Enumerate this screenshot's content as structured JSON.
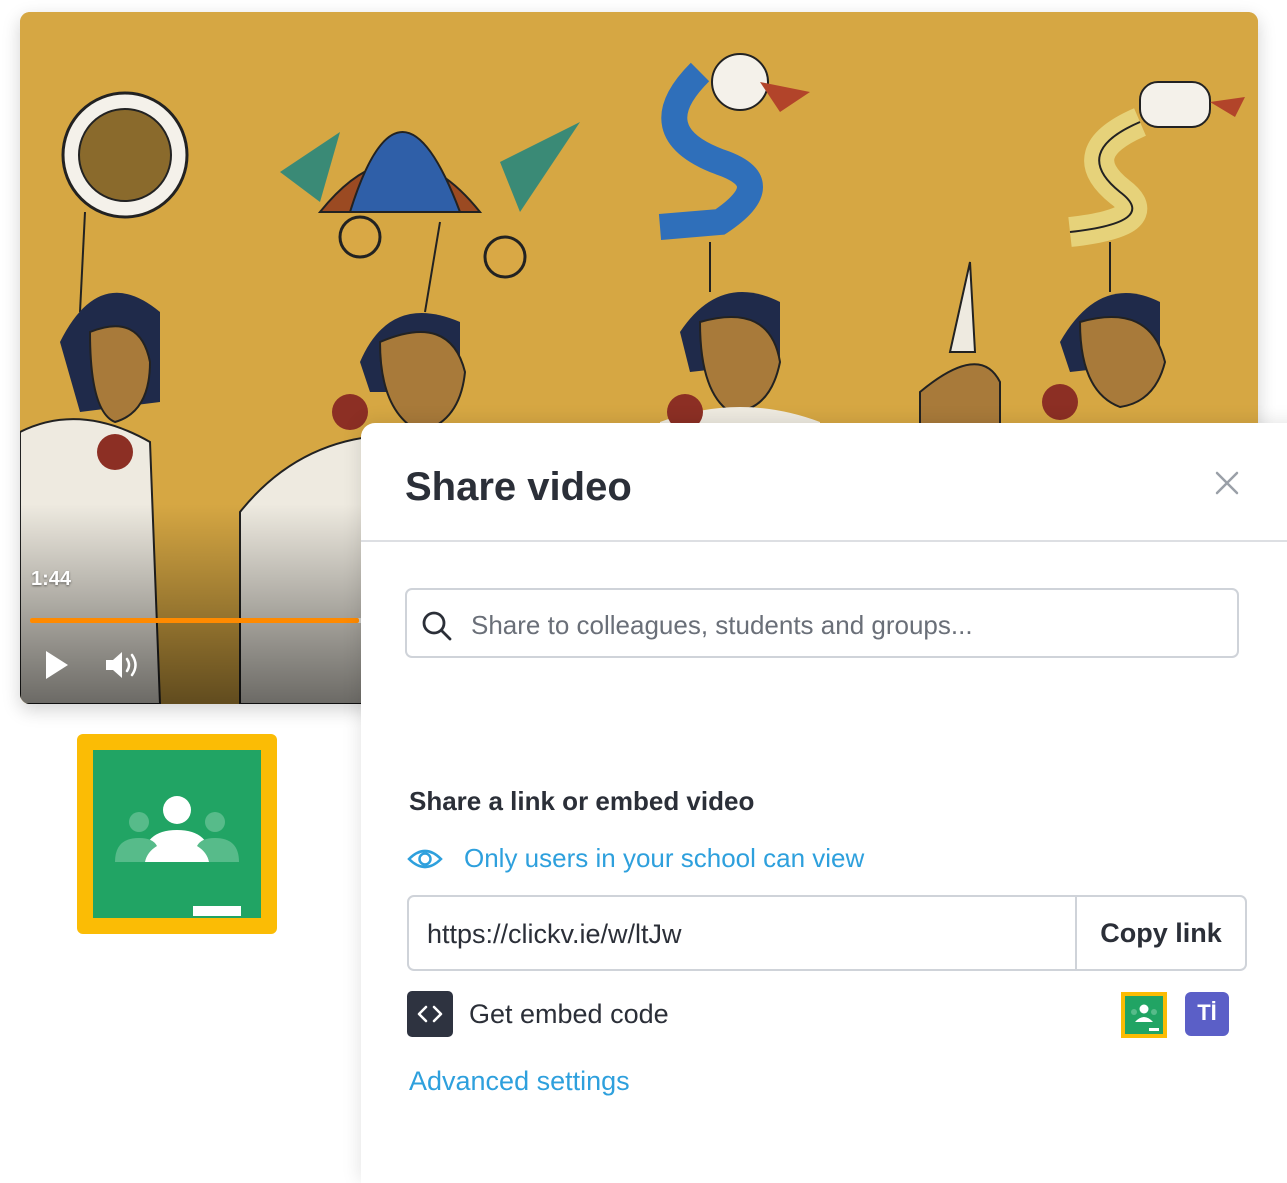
{
  "video": {
    "current_time": "1:44",
    "progress": 0.27,
    "controls": {
      "play_icon": "play-icon",
      "volume_icon": "volume-icon"
    },
    "accent_color": "#ff8a00"
  },
  "dialog": {
    "title": "Share video",
    "close_icon": "close-icon",
    "search": {
      "placeholder": "Share to colleagues, students and groups..."
    },
    "section_heading": "Share a link or embed video",
    "visibility_text": "Only users in your school can view",
    "link": {
      "url": "https://clickv.ie/w/ltJw",
      "copy_label": "Copy link"
    },
    "embed_label": "Get embed code",
    "integrations": [
      {
        "name": "Google Classroom",
        "icon": "google-classroom-icon"
      },
      {
        "name": "Microsoft Teams",
        "icon": "microsoft-teams-icon",
        "glyph": "Tİ"
      }
    ],
    "advanced_label": "Advanced settings",
    "link_color": "#2ea0dd"
  },
  "logo": {
    "icon": "google-classroom-logo",
    "border_color": "#fbbc05",
    "board_color": "#21a464"
  }
}
